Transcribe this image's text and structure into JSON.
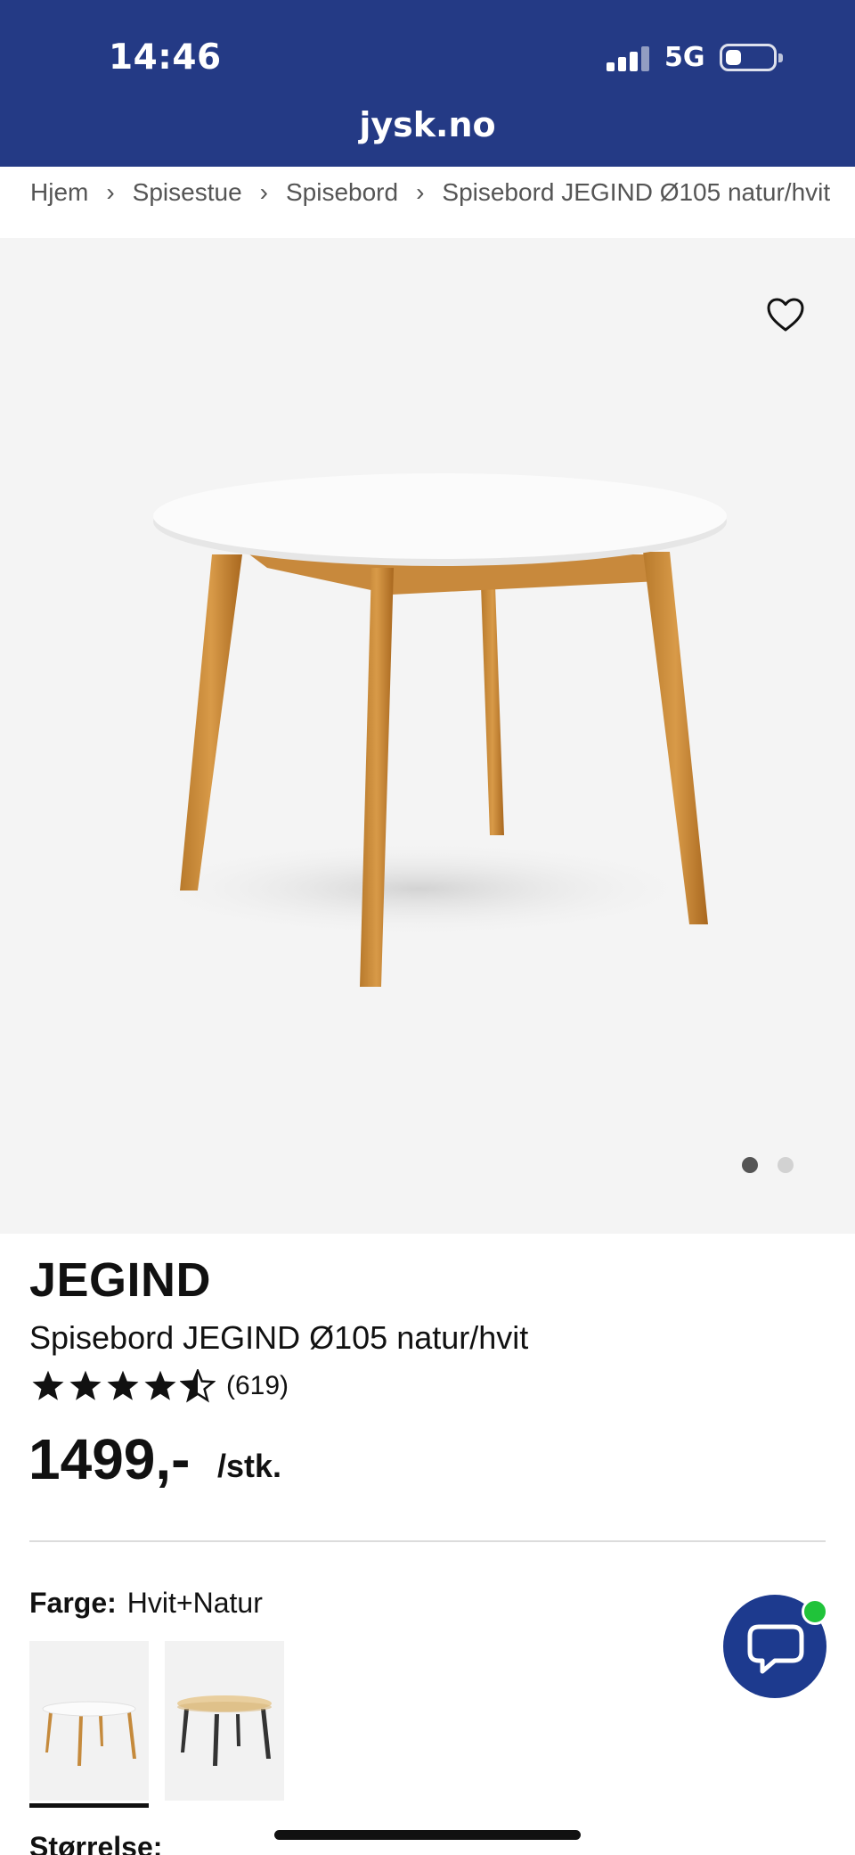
{
  "status_bar": {
    "time": "14:46",
    "network": "5G"
  },
  "browser": {
    "url": "jysk.no"
  },
  "breadcrumb": [
    "Hjem",
    "Spisestue",
    "Spisebord",
    "Spisebord JEGIND Ø105 natur/hvit"
  ],
  "gallery": {
    "dots": 2,
    "active_index": 0,
    "favorite_icon": "heart-icon"
  },
  "product": {
    "brand": "JEGIND",
    "name": "Spisebord JEGIND Ø105 natur/hvit",
    "rating_value": 4.5,
    "rating_count": "(619)",
    "price": "1499,-",
    "unit": "/stk."
  },
  "variants": {
    "color_label": "Farge:",
    "color_value": "Hvit+Natur",
    "options": [
      "Hvit+Natur",
      "Natur+Svart"
    ],
    "size_label": "Størrelse:"
  },
  "colors": {
    "brand_blue": "#243a85",
    "chat_blue": "#1d3a8e",
    "online_green": "#20c33a"
  }
}
